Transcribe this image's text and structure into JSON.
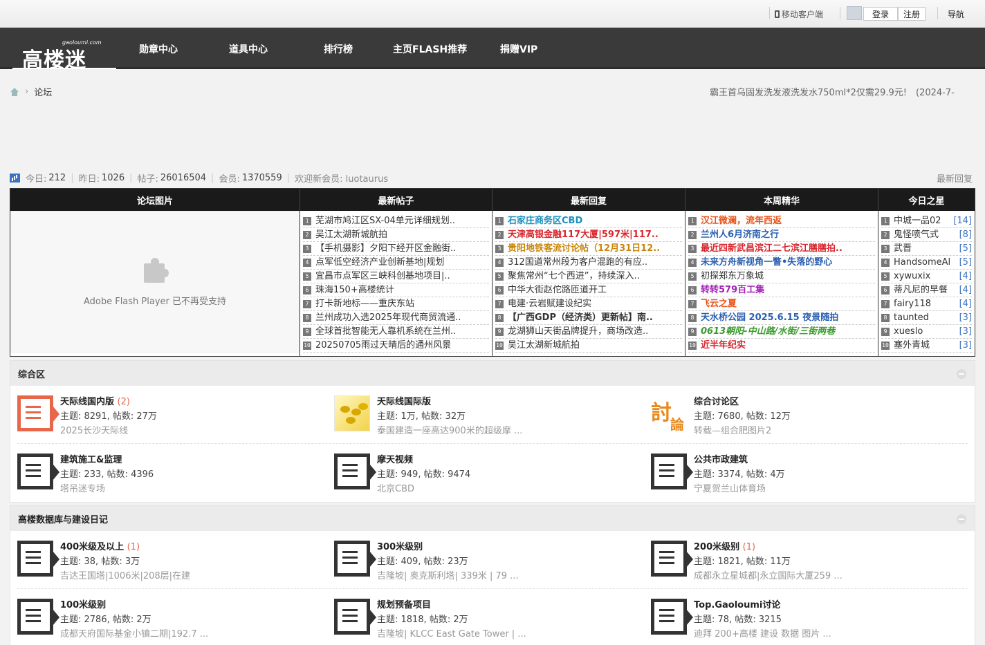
{
  "topbar": {
    "mobile_client": "移动客户端",
    "login": "登录",
    "register": "注册",
    "guide": "导航"
  },
  "logo": {
    "cn": "高楼迷",
    "en": "gaoloumi.com"
  },
  "nav": [
    "勋章中心",
    "道具中心",
    "排行榜",
    "主页FLASH推荐",
    "捐赠VIP"
  ],
  "breadcrumb": {
    "current": "论坛"
  },
  "announcement": "霸王首乌固发洗发液洗发水750ml*2仅需29.9元!　(2024-7-",
  "stats": {
    "today_label": "今日:",
    "today": "212",
    "yesterday_label": "昨日:",
    "yesterday": "1026",
    "posts_label": "帖子:",
    "posts": "26016504",
    "members_label": "会员:",
    "members": "1370559",
    "welcome": "欢迎新会员: luotaurus",
    "latest_reply": "最新回复"
  },
  "portal": {
    "headers": [
      "论坛图片",
      "最新帖子",
      "最新回复",
      "本周精华",
      "今日之星"
    ],
    "flash_text": "Adobe Flash Player 已不再受支持",
    "latest_posts": [
      "芜湖市鸠江区SX-04单元详细规划..",
      "吴江太湖新城航拍",
      "【手机摄影】夕阳下经开区金融街..",
      "点军低空经济产业创新基地|规划",
      "宜昌市点军区三峡科创基地项目|..",
      "珠海150+高楼统计",
      "打卡新地标——重庆东站",
      "兰州成功入选2025年现代商贸流通..",
      "全球首批智能无人靠机系统在兰州..",
      "20250705雨过天晴后的通州风景"
    ],
    "latest_replies": [
      {
        "t": "石家庄商务区CBD",
        "color": "#1a8fbf",
        "bold": true
      },
      {
        "t": "天津高银金融117大厦|597米|117..",
        "color": "#d8262d",
        "bold": true
      },
      {
        "t": "贵阳地铁客流讨论帖（12月31日12..",
        "color": "#c8860a",
        "bold": true
      },
      {
        "t": "312国道常州段为客户混跑的有应..",
        "color": "#333",
        "bold": false
      },
      {
        "t": "聚焦常州“七个西进”，持续深入..",
        "color": "#333",
        "bold": false
      },
      {
        "t": "中华大街赵佗路匝道开工",
        "color": "#333",
        "bold": false
      },
      {
        "t": "电建·云岩赋建设纪实",
        "color": "#333",
        "bold": false
      },
      {
        "t": "【广西GDP（经济类）更新帖】南..",
        "color": "#333",
        "bold": true
      },
      {
        "t": "龙湖狮山天街品牌提升，商场改造..",
        "color": "#333",
        "bold": false
      },
      {
        "t": "吴江太湖新城航拍",
        "color": "#333",
        "bold": false
      }
    ],
    "weekly_digest": [
      {
        "t": "汉江微澜，流年西返",
        "color": "#e8531a",
        "bold": true,
        "italic": false
      },
      {
        "t": "兰州人6月济南之行",
        "color": "#2a5fb0",
        "bold": true,
        "italic": false
      },
      {
        "t": "最近四新武昌滨江二七滨江膳膳拍..",
        "color": "#d8262d",
        "bold": true,
        "italic": false
      },
      {
        "t": "未来方舟新视角一瞥•失落的野心",
        "color": "#2a5fb0",
        "bold": true,
        "italic": false
      },
      {
        "t": "初探郑东万象城",
        "color": "#333",
        "bold": false,
        "italic": false
      },
      {
        "t": "转转579百工集",
        "color": "#a21fb8",
        "bold": true,
        "italic": false
      },
      {
        "t": "飞云之夏",
        "color": "#e8531a",
        "bold": true,
        "italic": false
      },
      {
        "t": "天水桥公园 2025.6.15 夜景随拍",
        "color": "#2a5fb0",
        "bold": true,
        "italic": false
      },
      {
        "t": "0613朝阳-中山路/水街/三街两巷",
        "color": "#3a9b2e",
        "bold": true,
        "italic": true
      },
      {
        "t": "近半年纪实",
        "color": "#d8262d",
        "bold": true,
        "italic": false
      }
    ],
    "today_stars": [
      {
        "name": "中城一品02",
        "count": "[14]"
      },
      {
        "name": "鬼怪喷气式",
        "count": "[8]"
      },
      {
        "name": "武晋",
        "count": "[5]"
      },
      {
        "name": "HandsomeAl",
        "count": "[5]"
      },
      {
        "name": "xywuxix",
        "count": "[4]"
      },
      {
        "name": "蒂凡尼的早餐",
        "count": "[4]"
      },
      {
        "name": "fairy118",
        "count": "[4]"
      },
      {
        "name": "taunted",
        "count": "[3]"
      },
      {
        "name": "xueslo",
        "count": "[3]"
      },
      {
        "name": "塞外青城",
        "count": "[3]"
      }
    ]
  },
  "groups": [
    {
      "title": "综合区",
      "rows": [
        [
          {
            "name": "天际线国内版",
            "new": "(2)",
            "stat": "主题: 8291, 帖数: 27万",
            "last": "2025长沙天际线",
            "icon": "doc-red"
          },
          {
            "name": "天际线国际版",
            "new": "",
            "stat": "主题: 1万, 帖数: 32万",
            "last": "泰国建造一座高达900米的超级摩 ...",
            "icon": "map"
          },
          {
            "name": "综合讨论区",
            "new": "",
            "stat": "主题: 7680, 帖数: 12万",
            "last": "转载—组合肥图片2",
            "icon": "taolun"
          }
        ],
        [
          {
            "name": "建筑施工&监理",
            "new": "",
            "stat": "主题: 233, 帖数: 4396",
            "last": "塔吊迷专场",
            "icon": "doc"
          },
          {
            "name": "摩天视频",
            "new": "",
            "stat": "主题: 949, 帖数: 9474",
            "last": "北京CBD",
            "icon": "doc"
          },
          {
            "name": "公共市政建筑",
            "new": "",
            "stat": "主题: 3374, 帖数: 4万",
            "last": "宁夏贺兰山体育场",
            "icon": "doc"
          }
        ]
      ]
    },
    {
      "title": "高楼数据库与建设日记",
      "rows": [
        [
          {
            "name": "400米级及以上",
            "new": "(1)",
            "stat": "主题: 38, 帖数: 3万",
            "last": "吉达王国塔|1006米|208层|在建",
            "icon": "doc"
          },
          {
            "name": "300米级别",
            "new": "",
            "stat": "主题: 409, 帖数: 23万",
            "last": "吉隆坡| 奥克斯利塔| 339米 | 79 ...",
            "icon": "doc"
          },
          {
            "name": "200米级别",
            "new": "(1)",
            "stat": "主题: 1821, 帖数: 11万",
            "last": "成都永立星城都|永立国际大厦259 ...",
            "icon": "doc"
          }
        ],
        [
          {
            "name": "100米级别",
            "new": "",
            "stat": "主题: 2786, 帖数: 2万",
            "last": "成都天府国际基金小镇二期|192.7 ...",
            "icon": "doc"
          },
          {
            "name": "规划预备项目",
            "new": "",
            "stat": "主题: 1818, 帖数: 2万",
            "last": "吉隆坡| KLCC East Gate Tower | ...",
            "icon": "doc"
          },
          {
            "name": "Top.Gaoloumi讨论",
            "new": "",
            "stat": "主题: 78, 帖数: 3215",
            "last": "迪拜 200+高楼 建设 数据 图片 ...",
            "icon": "doc"
          }
        ]
      ]
    }
  ]
}
